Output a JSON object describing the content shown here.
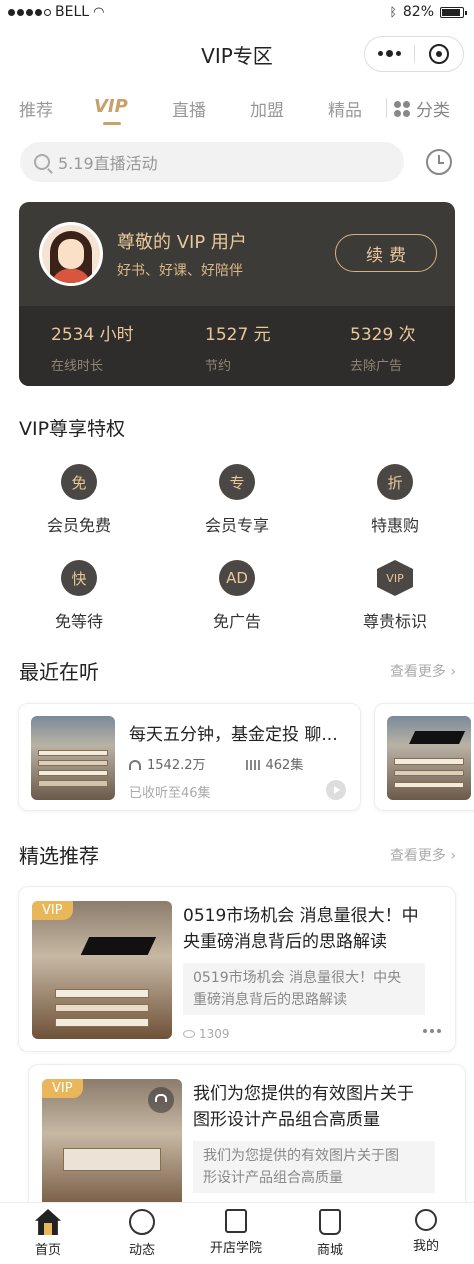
{
  "status": {
    "carrier": "BELL",
    "battery": "82%",
    "battery_level": 0.82
  },
  "nav": {
    "title": "VIP专区"
  },
  "tabs": [
    {
      "label": "推荐"
    },
    {
      "label": "VIP"
    },
    {
      "label": "直播"
    },
    {
      "label": "加盟"
    },
    {
      "label": "精品"
    },
    {
      "label": "分类"
    }
  ],
  "search": {
    "placeholder": "5.19直播活动"
  },
  "vip": {
    "title": "尊敬的 VIP 用户",
    "subtitle": "好书、好课、好陪伴",
    "renew_label": "续费",
    "stats": [
      {
        "value": "2534 小时",
        "label": "在线时长"
      },
      {
        "value": "1527 元",
        "label": "节约"
      },
      {
        "value": "5329 次",
        "label": "去除广告"
      }
    ]
  },
  "privileges": {
    "title": "VIP尊享特权",
    "items": [
      {
        "icon_text": "免",
        "label": "会员免费"
      },
      {
        "icon_text": "专",
        "label": "会员专享"
      },
      {
        "icon_text": "折",
        "label": "特惠购"
      },
      {
        "icon_text": "快",
        "label": "免等待"
      },
      {
        "icon_text": "AD",
        "label": "免广告"
      },
      {
        "icon_text": "VIP",
        "label": "尊贵标识"
      }
    ]
  },
  "recent": {
    "title": "最近在听",
    "more": "查看更多",
    "card": {
      "title": "每天五分钟，基金定投 聊...",
      "plays": "1542.2万",
      "episodes": "462集",
      "progress": "已收听至46集"
    }
  },
  "featured": {
    "title": "精选推荐",
    "more": "查看更多",
    "items": [
      {
        "tag": "VIP",
        "title_line1": "0519市场机会  消息量很大！中",
        "title_line2": "央重磅消息背后的思路解读",
        "desc_line1": "0519市场机会  消息量很大！中央",
        "desc_line2": "重磅消息背后的思路解读",
        "views": "1309"
      },
      {
        "tag": "VIP",
        "title_line1": "我们为您提供的有效图片关于",
        "title_line2": "图形设计产品组合高质量",
        "desc_line1": "我们为您提供的有效图片关于图",
        "desc_line2": "形设计产品组合高质量"
      }
    ]
  },
  "tabbar": [
    {
      "label": "首页",
      "icon": "home-icon"
    },
    {
      "label": "动态",
      "icon": "chat-icon"
    },
    {
      "label": "开店学院",
      "icon": "book-icon"
    },
    {
      "label": "商城",
      "icon": "bag-icon"
    },
    {
      "label": "我的",
      "icon": "user-icon"
    }
  ],
  "colors": {
    "accent": "#c8a06a",
    "vip_tag": "#e9b75a",
    "card_dark": "#3d3b38"
  }
}
